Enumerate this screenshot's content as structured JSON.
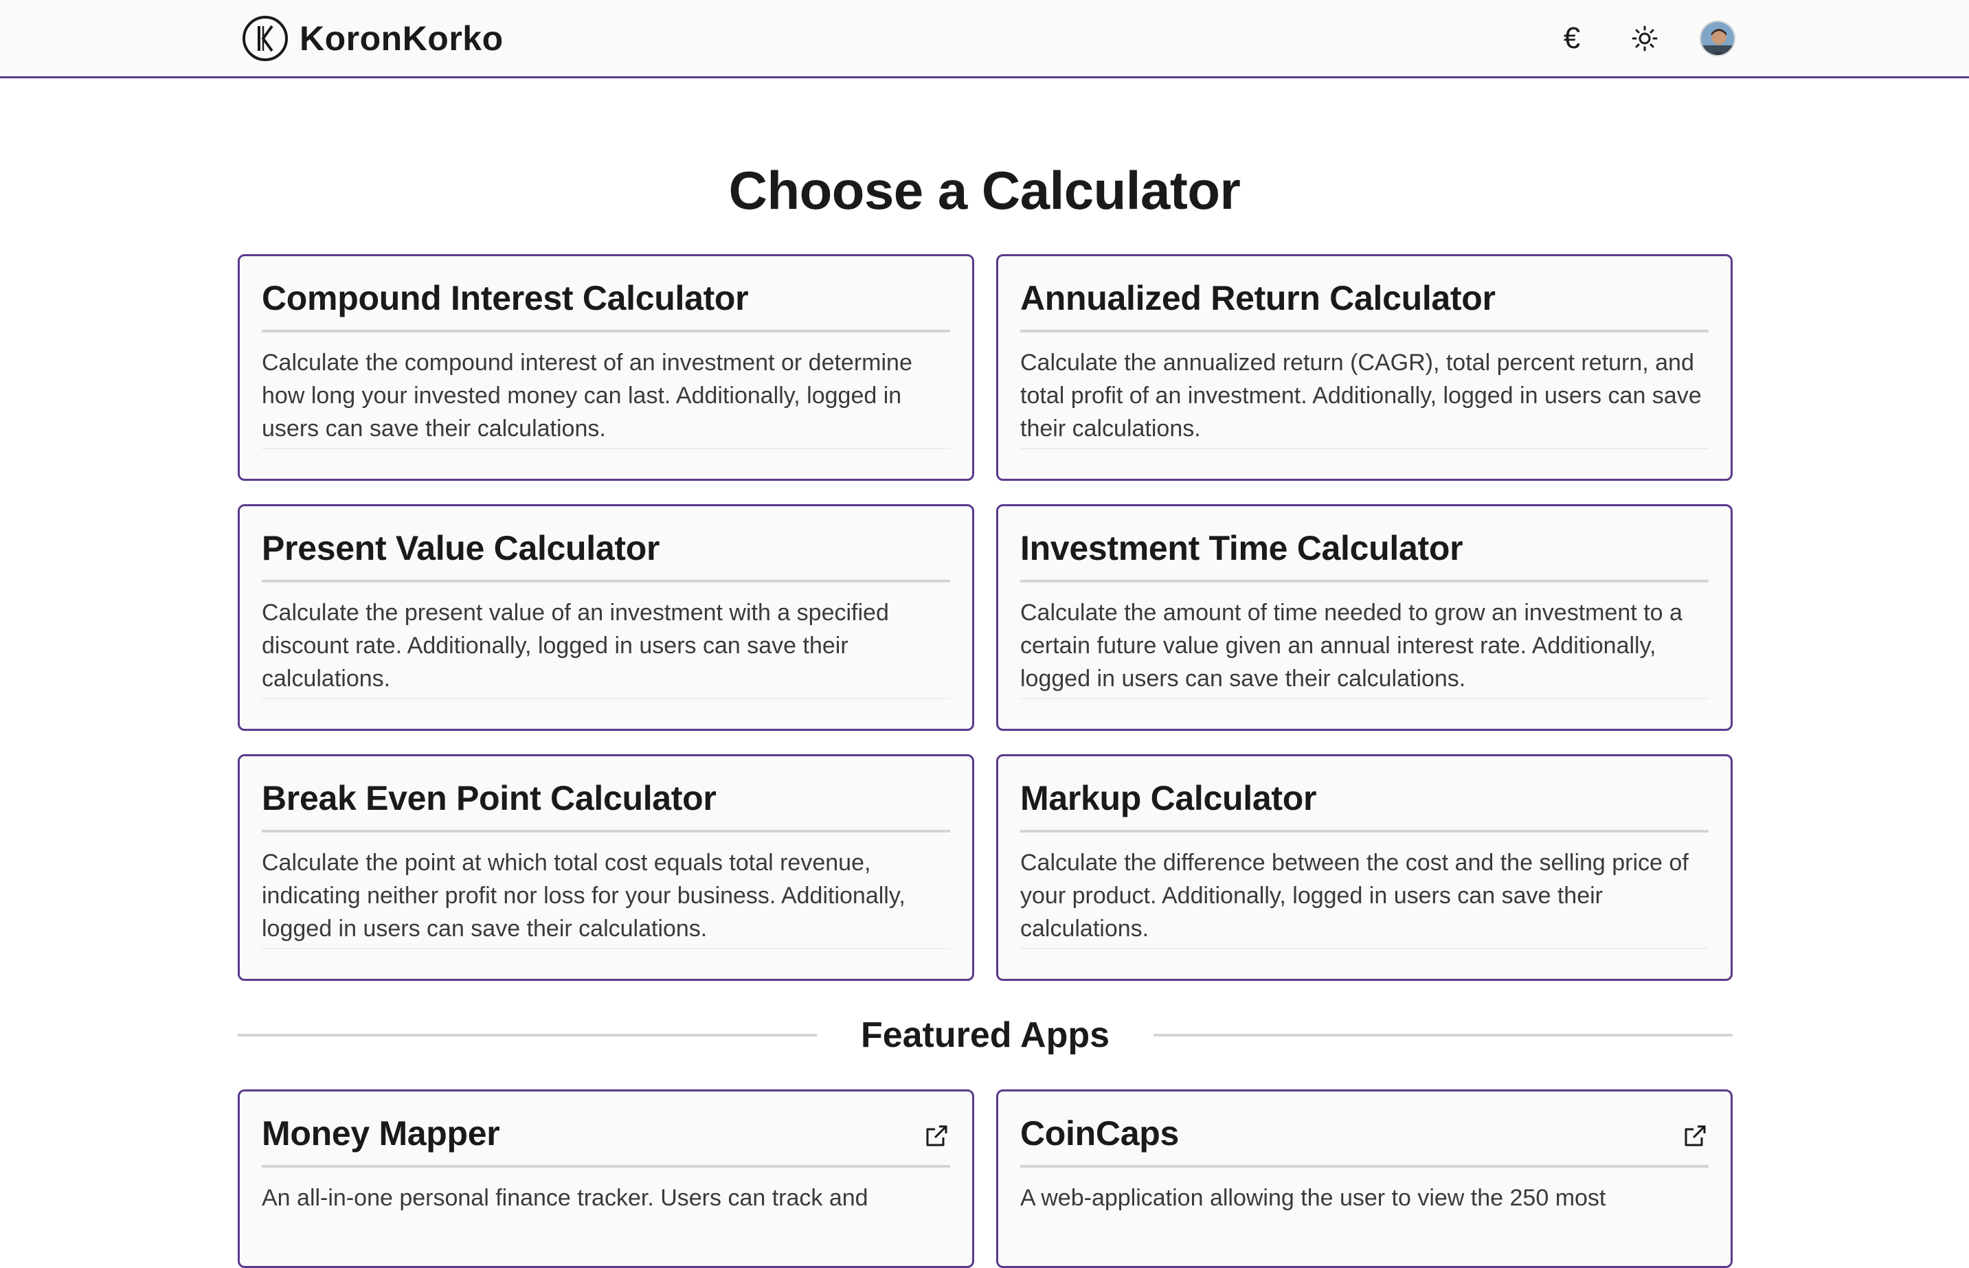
{
  "header": {
    "brand_name": "KoronKorko",
    "currency_symbol": "€",
    "icons": {
      "logo": "koronkorko-logo-icon",
      "currency": "euro-icon",
      "theme": "sun-icon",
      "avatar": "user-avatar"
    }
  },
  "main": {
    "title": "Choose a Calculator",
    "calculators": [
      {
        "title": "Compound Interest Calculator",
        "description": "Calculate the compound interest of an investment or determine how long your invested money can last. Additionally, logged in users can save their calculations."
      },
      {
        "title": "Annualized Return Calculator",
        "description": "Calculate the annualized return (CAGR), total percent return, and total profit of an investment. Additionally, logged in users can save their calculations."
      },
      {
        "title": "Present Value Calculator",
        "description": "Calculate the present value of an investment with a specified discount rate. Additionally, logged in users can save their calculations."
      },
      {
        "title": "Investment Time Calculator",
        "description": "Calculate the amount of time needed to grow an investment to a certain future value given an annual interest rate. Additionally, logged in users can save their calculations."
      },
      {
        "title": "Break Even Point Calculator",
        "description": "Calculate the point at which total cost equals total revenue, indicating neither profit nor loss for your business. Additionally, logged in users can save their calculations."
      },
      {
        "title": "Markup Calculator",
        "description": "Calculate the difference between the cost and the selling price of your product. Additionally, logged in users can save their calculations."
      }
    ],
    "featured_title": "Featured Apps",
    "featured_apps": [
      {
        "title": "Money Mapper",
        "description": "An all-in-one personal finance tracker. Users can track and"
      },
      {
        "title": "CoinCaps",
        "description": "A web-application allowing the user to view the 250 most"
      }
    ]
  },
  "colors": {
    "accent": "#5b3a8c",
    "card_bg": "#fafafa",
    "divider": "#d4d4d4",
    "text": "#1a1a1a"
  }
}
